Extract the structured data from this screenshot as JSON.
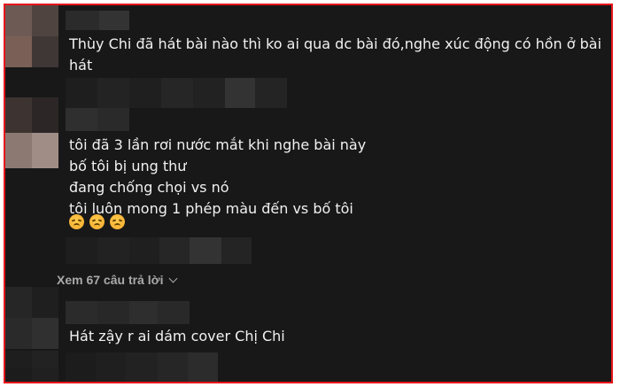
{
  "comments": [
    {
      "lines": [
        "Thùy Chi đã hát bài nào thì ko ai qua dc bài đó,nghe xúc động có hồn ở bài",
        "hát"
      ]
    },
    {
      "lines": [
        "tôi đã 3 lần rơi nước mắt khi nghe bài này",
        "bố tôi bị ung thư",
        "đang chống chọi vs nó",
        "tôi luôn mong 1 phép màu đến vs bố tôi"
      ],
      "emojis": [
        "disappointed-face-emoji",
        "disappointed-face-emoji",
        "disappointed-face-emoji"
      ]
    },
    {
      "lines": [
        "Hát zậy r ai dám cover Chị Chi"
      ]
    }
  ],
  "replies_label": "Xem 67 câu trả lời",
  "colors": {
    "border": "#e8141b",
    "background": "#181818",
    "text": "#f1f1f1",
    "replies_text": "#aaaaaa"
  }
}
